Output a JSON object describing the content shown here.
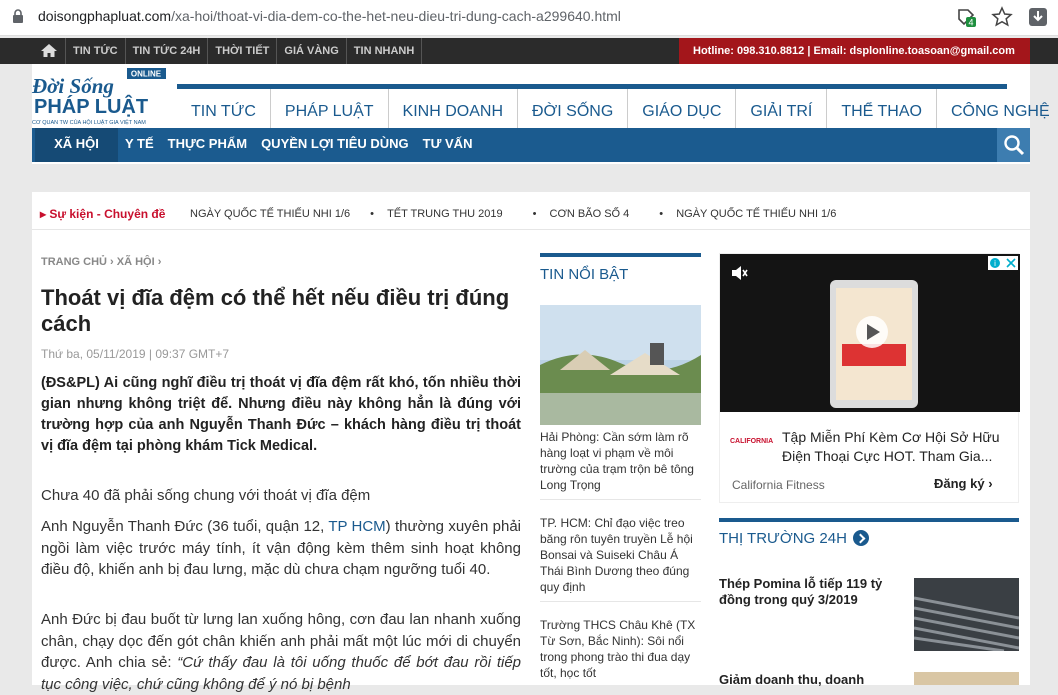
{
  "browser": {
    "url_domain": "doisongphapluat.com",
    "url_path": "/xa-hoi/thoat-vi-dia-dem-co-the-het-neu-dieu-tri-dung-cach-a299640.html",
    "ext_badge": "4"
  },
  "topbar": {
    "items": [
      "TIN TỨC",
      "TIN TỨC 24H",
      "THỜI TIẾT",
      "GIÁ VÀNG",
      "TIN NHANH"
    ],
    "hotline": "Hotline: 098.310.8812 | Email:  dsplonline.toasoan@gmail.com"
  },
  "logo": {
    "line1": "Đời Sống",
    "line2": "PHÁP LUẬT",
    "badge": "ONLINE",
    "tagline": "CƠ QUAN TW CỦA HỘI LUẬT GIA VIỆT NAM"
  },
  "mainnav": [
    "TIN TỨC",
    "PHÁP LUẬT",
    "KINH DOANH",
    "ĐỜI SỐNG",
    "GIÁO DỤC",
    "GIẢI TRÍ",
    "THỂ THAO",
    "CÔNG NGHỆ"
  ],
  "subnav": {
    "current": "XÃ HỘI",
    "items": [
      "Y TẾ",
      "THỰC PHẨM",
      "QUYỀN LỢI TIÊU DÙNG",
      "TƯ VẤN"
    ]
  },
  "event": {
    "label": "Sự kiện - Chuyên đề",
    "tags": [
      "NGÀY QUỐC TẾ THIẾU NHI 1/6",
      "TẾT TRUNG THU 2019",
      "CƠN BÃO SỐ 4",
      "NGÀY QUỐC TẾ THIẾU NHI 1/6"
    ]
  },
  "article": {
    "breadcrumb1": "TRANG CHỦ",
    "breadcrumb2": "XÃ HỘI",
    "title": "Thoát vị đĩa đệm có thể hết nếu điều trị đúng cách",
    "date": "Thứ ba, 05/11/2019 | 09:37 GMT+7",
    "lead": "(ĐS&PL) Ai cũng nghĩ điều trị thoát vị đĩa đệm rất khó, tốn nhiều thời gian nhưng không triệt để. Nhưng điều này không hẳn là đúng với trường hợp của anh Nguyễn Thanh Đức – khách hàng điều trị thoát vị đĩa đệm tại phòng khám Tick Medical.",
    "subheading": "Chưa 40 đã phải sống chung với thoát vị đĩa đệm",
    "p1_a": "Anh Nguyễn Thanh Đức (36 tuổi, quận 12, ",
    "p1_link": "TP HCM",
    "p1_b": ") thường xuyên phải ngồi làm việc trước máy tính, ít vận động kèm thêm sinh hoạt không điều độ, khiến anh bị đau lưng, mặc dù chưa chạm ngưỡng tuổi 40.",
    "p2_a": "Anh Đức bị đau buốt từ lưng lan xuống hông, cơn đau lan nhanh xuống chân, chạy dọc đến gót chân khiến anh phải mất một lúc mới di chuyển được. Anh chia sẻ: ",
    "p2_quote": "“Cứ thấy đau là tôi uống thuốc để bớt đau rồi tiếp tục công việc, chứ cũng không để ý nó bị bệnh"
  },
  "hot": {
    "heading": "TIN NỔI BẬT",
    "items": [
      "Hải Phòng: Cần sớm làm rõ hàng loạt vi phạm về môi trường của trạm trộn bê tông Long Trọng",
      "TP. HCM: Chỉ đạo việc treo băng rôn tuyên truyền Lễ hội Bonsai và Suiseki Châu Á Thái Bình Dương theo đúng quy định",
      "Trường THCS Châu Khê (TX Từ Sơn, Bắc Ninh): Sôi nổi trong phong trào thi đua dạy tốt, học tốt"
    ]
  },
  "ad": {
    "text": "Tập Miễn Phí Kèm Cơ Hội Sở Hữu Điện Thoại Cực HOT. Tham Gia...",
    "brand": "California Fitness",
    "cta": "Đăng ký",
    "logo": "CALIFORNIA"
  },
  "market": {
    "heading": "THỊ TRƯỜNG 24H",
    "item1": "Thép Pomina lỗ tiếp 119 tỷ đồng trong quý 3/2019",
    "item2": "Giảm doanh thu, doanh"
  },
  "colors": {
    "brand_blue": "#1a5a8e",
    "red": "#a3161b",
    "sub_nav": "#1b5b8f"
  }
}
